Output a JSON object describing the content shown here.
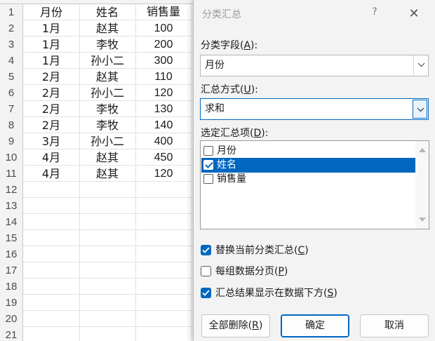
{
  "sheet": {
    "row_numbers": [
      "1",
      "2",
      "3",
      "4",
      "5",
      "6",
      "7",
      "8",
      "9",
      "10",
      "11",
      "12",
      "13",
      "14",
      "15",
      "16",
      "17",
      "18",
      "19",
      "20",
      "21"
    ],
    "header": [
      "月份",
      "姓名",
      "销售量"
    ],
    "rows": [
      [
        "1月",
        "赵其",
        "100"
      ],
      [
        "1月",
        "李牧",
        "200"
      ],
      [
        "1月",
        "孙小二",
        "300"
      ],
      [
        "2月",
        "赵其",
        "110"
      ],
      [
        "2月",
        "孙小二",
        "120"
      ],
      [
        "2月",
        "李牧",
        "130"
      ],
      [
        "2月",
        "李牧",
        "140"
      ],
      [
        "3月",
        "孙小二",
        "400"
      ],
      [
        "4月",
        "赵其",
        "450"
      ],
      [
        "4月",
        "赵其",
        "120"
      ]
    ]
  },
  "dialog": {
    "title": "分类汇总",
    "help_glyph": "?",
    "close_glyph": "✕",
    "group_field": {
      "label": "分类字段(",
      "key": "A",
      "label_end": "):",
      "value": "月份"
    },
    "function": {
      "label": "汇总方式(",
      "key": "U",
      "label_end": "):",
      "value": "求和"
    },
    "add_to": {
      "label": "选定汇总项(",
      "key": "D",
      "label_end": "):",
      "items": [
        {
          "text": "月份",
          "checked": false,
          "selected": false
        },
        {
          "text": "姓名",
          "checked": true,
          "selected": true
        },
        {
          "text": "销售量",
          "checked": false,
          "selected": false
        }
      ]
    },
    "options": [
      {
        "text": "替换当前分类汇总(",
        "key": "C",
        "end": ")",
        "checked": true
      },
      {
        "text": "每组数据分页(",
        "key": "P",
        "end": ")",
        "checked": false
      },
      {
        "text": "汇总结果显示在数据下方(",
        "key": "S",
        "end": ")",
        "checked": true
      }
    ],
    "buttons": {
      "remove_all": {
        "text": "全部删除(",
        "key": "R",
        "end": ")"
      },
      "ok": "确定",
      "cancel": "取消"
    }
  },
  "colors": {
    "accent": "#0067c0",
    "dialog_bg": "#f3f3f3",
    "header_bg": "#f3f3f3"
  }
}
